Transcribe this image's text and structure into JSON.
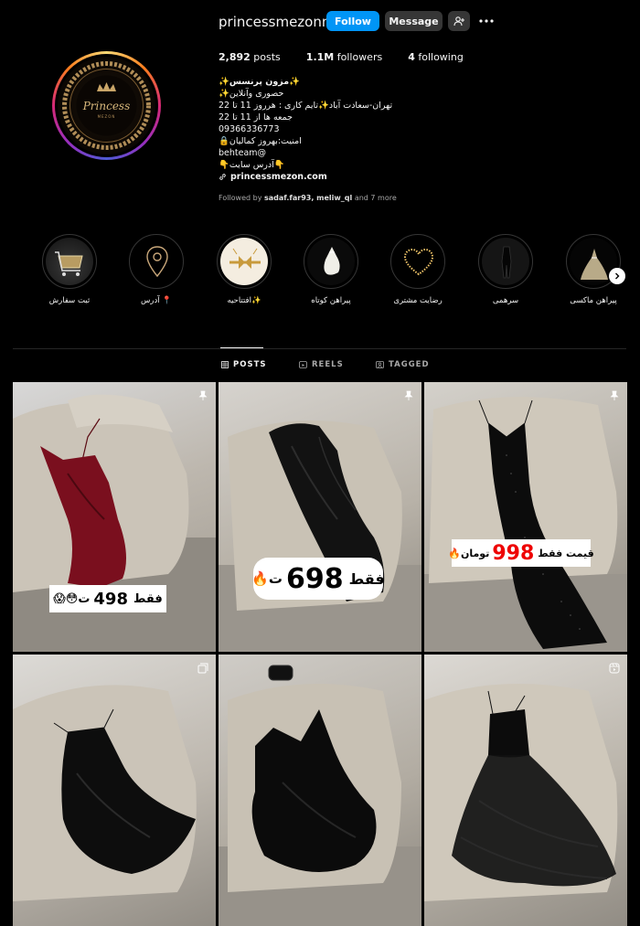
{
  "profile": {
    "username": "princessmezonn",
    "follow_label": "Follow",
    "message_label": "Message",
    "logo_text": "Princess",
    "logo_subtext": "MEZON"
  },
  "stats": {
    "posts_count": "2,892",
    "posts_label": "posts",
    "followers_count": "1.1M",
    "followers_label": "followers",
    "following_count": "4",
    "following_label": "following"
  },
  "bio": {
    "name": "✨مزون پرنسس✨",
    "lines": [
      "✨حصوری وآنلاین",
      "تهران-سعادت آباد✨تایم کاری : هرروز 11 تا 22",
      "جمعه ها از 11 تا 22",
      "09366336773",
      "🔒امنیت:بهروز کمالیان",
      "behteam@",
      "👇آدرس سایت👇"
    ],
    "link": "princessmezon.com",
    "followed_prefix": "Followed by",
    "followed_users": "sadaf.far93, meliw_ql",
    "followed_suffix": "and 7 more"
  },
  "highlights": [
    {
      "label": "ثبت سفارش"
    },
    {
      "label": "آدرس 📍"
    },
    {
      "label": "افتتاحیه✨"
    },
    {
      "label": "پیراهن کوتاه"
    },
    {
      "label": "رضایت مشتری"
    },
    {
      "label": "سرهمی"
    },
    {
      "label": "پیراهن ماکسی"
    }
  ],
  "tabs": {
    "posts": "POSTS",
    "reels": "REELS",
    "tagged": "TAGGED"
  },
  "posts": [
    {
      "price_text": "فقط 498 ت😳😱",
      "price_prefix": "فقط",
      "price_num": "498",
      "price_suffix": "ت😳😱"
    },
    {
      "price_prefix": "فقط",
      "price_num": "698",
      "price_suffix": "ت🔥"
    },
    {
      "price_prefix": "قیمت فقط",
      "price_num": "998",
      "price_suffix": "تومان🔥"
    }
  ],
  "colors": {
    "follow_blue": "#0095f6",
    "velvet_red": "#7a0f1e",
    "price_red": "#e00000"
  }
}
